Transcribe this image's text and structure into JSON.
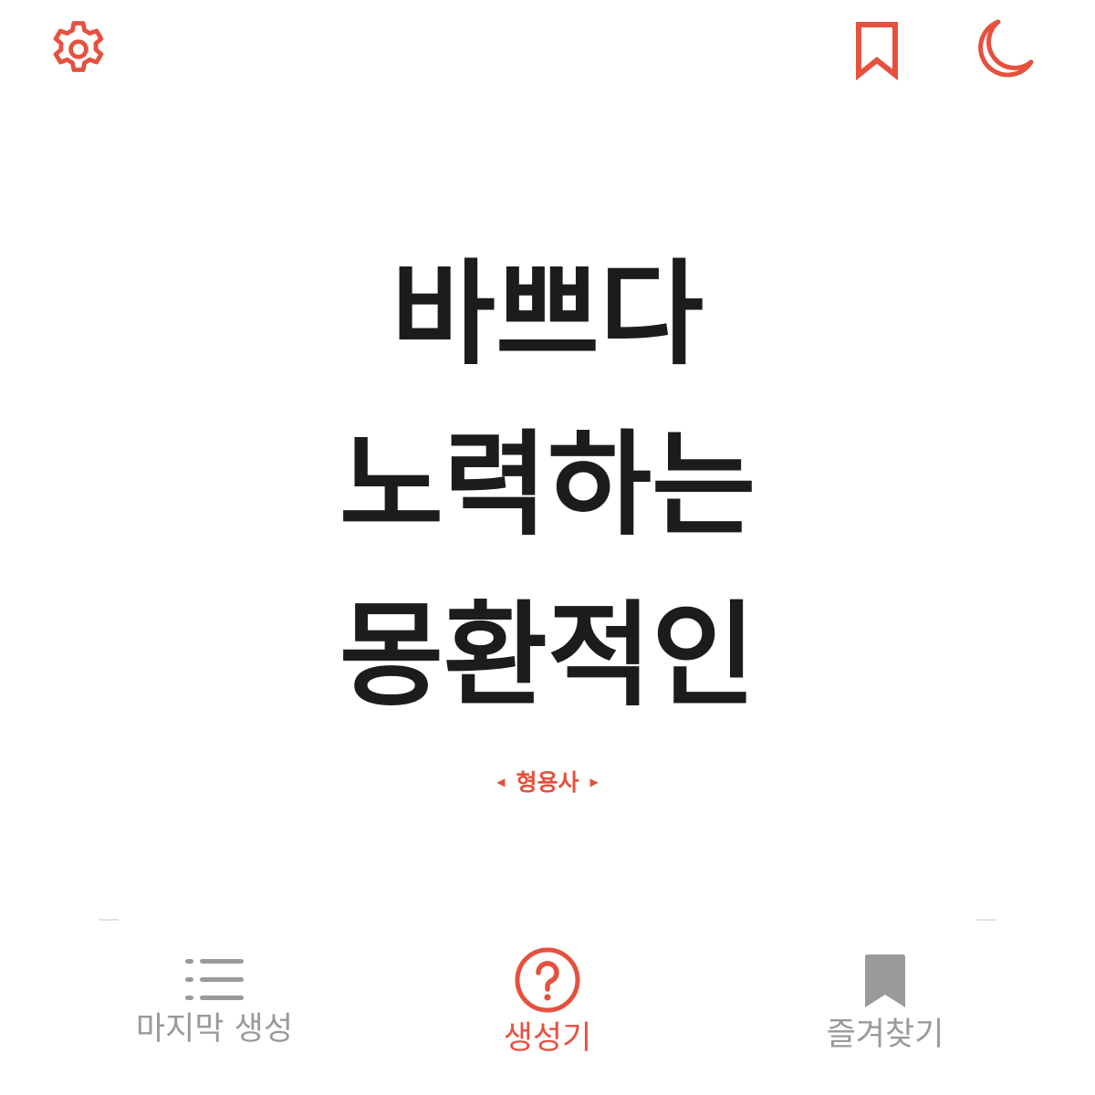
{
  "header": {
    "settings_icon": "gear-icon",
    "bookmark_icon": "bookmark-outline-icon",
    "theme_icon": "crescent-moon-icon",
    "accent_color": "#e6503e"
  },
  "words": [
    "바쁘다",
    "노력하는",
    "몽환적인"
  ],
  "part_of_speech": {
    "label": "형용사",
    "prev_icon": "triangle-left-icon",
    "next_icon": "triangle-right-icon"
  },
  "tabs": [
    {
      "label": "마지막 생성",
      "icon": "list-icon",
      "active": false
    },
    {
      "label": "생성기",
      "icon": "question-circle-icon",
      "active": true
    },
    {
      "label": "즐겨찾기",
      "icon": "bookmark-filled-icon",
      "active": false
    }
  ],
  "colors": {
    "accent": "#e6503e",
    "text": "#1c1c1c",
    "inactive": "#9a9a9a"
  }
}
